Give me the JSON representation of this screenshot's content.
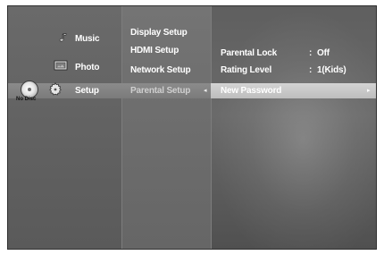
{
  "colors": {
    "panel_bg": "#6a6a6a",
    "panel_border": "#2f2f2f",
    "highlight_row": "#8b8b8b",
    "highlight_selected": "#d4d4d4",
    "text_primary": "#ffffff",
    "text_dim": "#cfcfcf"
  },
  "left_menu": {
    "items": [
      {
        "label": "Music",
        "icon": "music-note-icon"
      },
      {
        "label": "Photo",
        "icon": "photo-icon"
      },
      {
        "label": "Setup",
        "icon": "gear-icon"
      }
    ],
    "no_disc_label": "No Disc"
  },
  "setup_menu": {
    "items": [
      {
        "label": "Display Setup"
      },
      {
        "label": "HDMI Setup"
      },
      {
        "label": "Network Setup"
      },
      {
        "label": "Parental Setup"
      }
    ]
  },
  "parental_setup": {
    "rows": [
      {
        "label": "Parental Lock",
        "separator": ":",
        "value": "Off"
      },
      {
        "label": "Rating Level",
        "separator": ":",
        "value": "1(Kids)"
      }
    ],
    "selected_item": {
      "label": "New Password"
    }
  }
}
